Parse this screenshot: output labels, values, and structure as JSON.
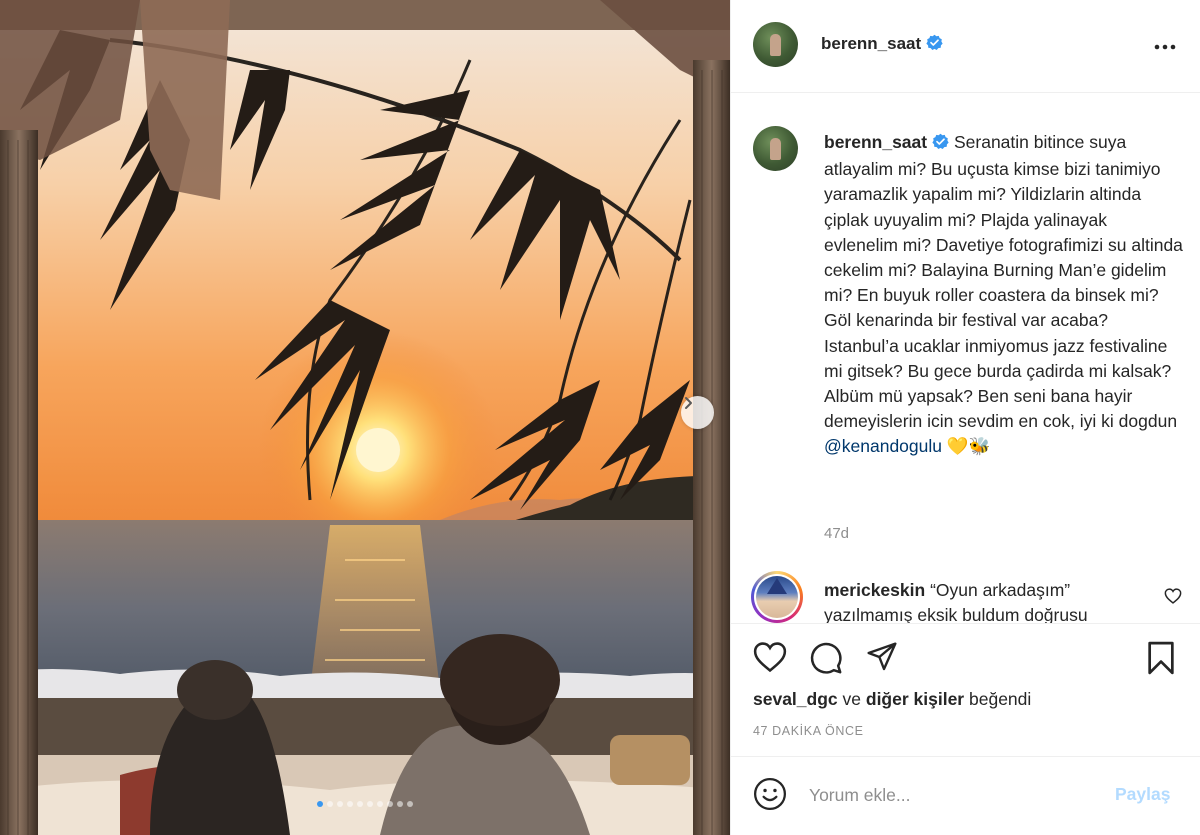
{
  "post": {
    "username": "berenn_saat",
    "verified": true,
    "more_icon": "more-horizontal-icon",
    "caption_text": "Seranatin bitince suya atlayalim mi? Bu uçusta kimse bizi tanimiyo yaramazlik yapalim mi? Yildizlarin altinda çiplak uyuyalim mi? Plajda yalinayak evlenelim mi? Davetiye fotografimizi su altinda cekelim mi? Balayina Burning Man’e gidelim mi? En buyuk roller coastera da binsek mi? Göl kenarinda bir festival var acaba? Istanbul’a ucaklar inmiyomus jazz festivaline mi gitsek? Bu gece burda çadirda mi kalsak? Albüm mü yapsak? Ben seni bana hayir demeyislerin icin sevdim en cok, iyi ki dogdun",
    "mention": "@kenandogulu",
    "emojis": "💛🐝",
    "age": "47d",
    "carousel": {
      "slides": 10,
      "active": 0
    }
  },
  "comment": {
    "username": "merickeskin",
    "text": "“Oyun arkadaşım” yazılmamış eksik buldum doğrusu"
  },
  "actions": {
    "like_icon": "heart-icon",
    "comment_icon": "comment-icon",
    "share_icon": "send-icon",
    "save_icon": "bookmark-icon",
    "liked_by_user": "seval_dgc",
    "and_text": "ve",
    "others_text": "diğer kişiler",
    "liked_text": "beğendi",
    "time_ago": "47 DAKİKA ÖNCE"
  },
  "add_comment": {
    "placeholder": "Yorum ekle...",
    "share_label": "Paylaş"
  },
  "colors": {
    "verified": "#3897f0",
    "mention": "#00376b",
    "share_disabled": "#b3dbff",
    "active_dot": "#3897f0"
  }
}
